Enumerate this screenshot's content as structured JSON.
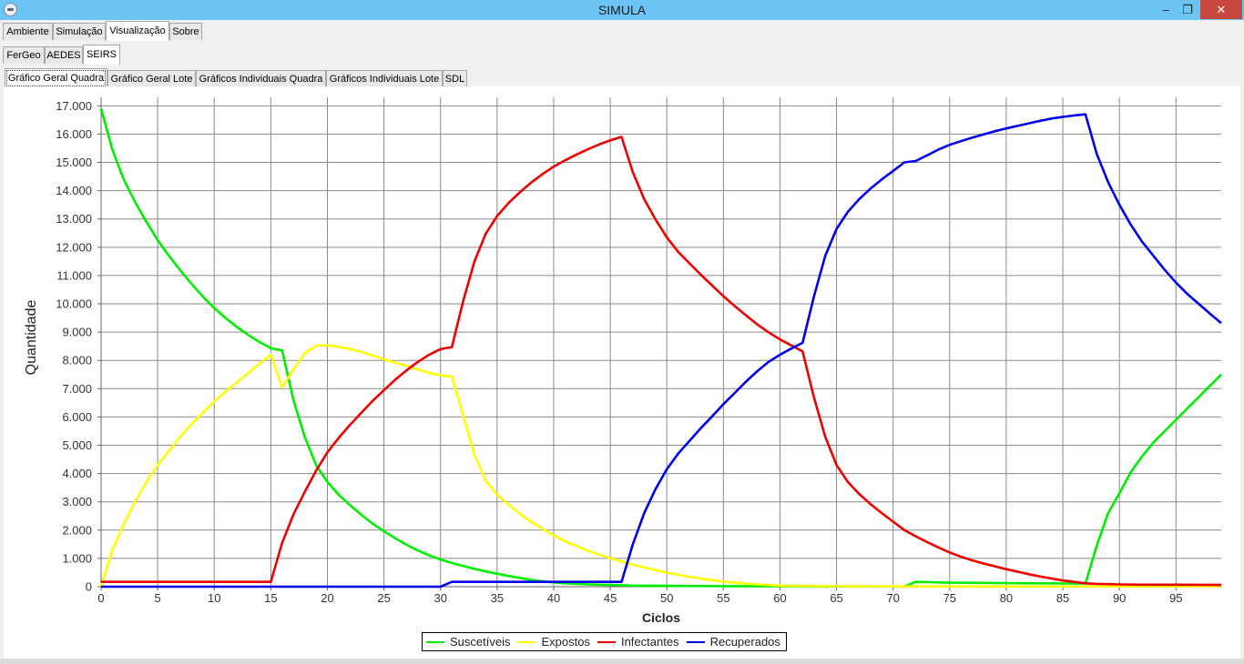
{
  "window": {
    "title": "SIMULA",
    "minimize_glyph": "–",
    "restore_glyph": "❐",
    "close_glyph": "✕"
  },
  "tabs_main": [
    {
      "label": "Ambiente"
    },
    {
      "label": "Simulação"
    },
    {
      "label": "Visualização"
    },
    {
      "label": "Sobre"
    }
  ],
  "tabs_sub": [
    {
      "label": "FerGeo"
    },
    {
      "label": "AEDES"
    },
    {
      "label": "SEIRS"
    }
  ],
  "tabs_chart": [
    {
      "label": "Gráfico Geral Quadra"
    },
    {
      "label": "Gráfico Geral Lote"
    },
    {
      "label": "Gráficos Individuais Quadra"
    },
    {
      "label": "Gráficos Individuais Lote"
    },
    {
      "label": "SDL"
    }
  ],
  "chart_data": {
    "type": "line",
    "xlabel": "Ciclos",
    "ylabel": "Quantidade",
    "xlim": [
      0,
      99
    ],
    "ylim": [
      0,
      17300
    ],
    "x_ticks": [
      0,
      5,
      10,
      15,
      20,
      25,
      30,
      35,
      40,
      45,
      50,
      55,
      60,
      65,
      70,
      75,
      80,
      85,
      90,
      95
    ],
    "y_ticks": [
      0,
      1000,
      2000,
      3000,
      4000,
      5000,
      6000,
      7000,
      8000,
      9000,
      10000,
      11000,
      12000,
      13000,
      14000,
      15000,
      16000,
      17000
    ],
    "y_tick_labels": [
      "0",
      "1.000",
      "2.000",
      "3.000",
      "4.000",
      "5.000",
      "6.000",
      "7.000",
      "8.000",
      "9.000",
      "10.000",
      "11.000",
      "12.000",
      "13.000",
      "14.000",
      "15.000",
      "16.000",
      "17.000"
    ],
    "grid": true,
    "legend_position": "bottom-center",
    "series": [
      {
        "name": "Suscetíveis",
        "color": "#00ee00",
        "points": [
          [
            0,
            16900
          ],
          [
            1,
            15450
          ],
          [
            2,
            14400
          ],
          [
            3,
            13600
          ],
          [
            4,
            12900
          ],
          [
            5,
            12250
          ],
          [
            6,
            11700
          ],
          [
            7,
            11180
          ],
          [
            8,
            10700
          ],
          [
            9,
            10250
          ],
          [
            10,
            9850
          ],
          [
            11,
            9500
          ],
          [
            12,
            9180
          ],
          [
            13,
            8900
          ],
          [
            14,
            8650
          ],
          [
            15,
            8430
          ],
          [
            16,
            8350
          ],
          [
            17,
            6600
          ],
          [
            18,
            5300
          ],
          [
            19,
            4300
          ],
          [
            20,
            3700
          ],
          [
            21,
            3250
          ],
          [
            22,
            2880
          ],
          [
            23,
            2540
          ],
          [
            24,
            2230
          ],
          [
            25,
            1960
          ],
          [
            26,
            1710
          ],
          [
            27,
            1480
          ],
          [
            28,
            1280
          ],
          [
            29,
            1110
          ],
          [
            30,
            960
          ],
          [
            31,
            840
          ],
          [
            32,
            730
          ],
          [
            33,
            630
          ],
          [
            34,
            540
          ],
          [
            35,
            460
          ],
          [
            36,
            380
          ],
          [
            37,
            310
          ],
          [
            38,
            240
          ],
          [
            39,
            190
          ],
          [
            40,
            150
          ],
          [
            41,
            120
          ],
          [
            42,
            100
          ],
          [
            43,
            80
          ],
          [
            44,
            70
          ],
          [
            45,
            60
          ],
          [
            46,
            50
          ],
          [
            47,
            40
          ],
          [
            48,
            35
          ],
          [
            50,
            30
          ],
          [
            55,
            20
          ],
          [
            60,
            15
          ],
          [
            65,
            10
          ],
          [
            70,
            8
          ],
          [
            71,
            5
          ],
          [
            72,
            170
          ],
          [
            73,
            160
          ],
          [
            75,
            140
          ],
          [
            80,
            125
          ],
          [
            85,
            115
          ],
          [
            87,
            110
          ],
          [
            88,
            1450
          ],
          [
            89,
            2600
          ],
          [
            90,
            3300
          ],
          [
            91,
            4050
          ],
          [
            92,
            4600
          ],
          [
            93,
            5100
          ],
          [
            94,
            5500
          ],
          [
            95,
            5900
          ],
          [
            96,
            6300
          ],
          [
            97,
            6700
          ],
          [
            98,
            7100
          ],
          [
            99,
            7500
          ]
        ]
      },
      {
        "name": "Expostos",
        "color": "#ffff00",
        "points": [
          [
            0,
            0
          ],
          [
            1,
            1300
          ],
          [
            2,
            2200
          ],
          [
            3,
            3000
          ],
          [
            4,
            3700
          ],
          [
            5,
            4300
          ],
          [
            6,
            4800
          ],
          [
            7,
            5300
          ],
          [
            8,
            5750
          ],
          [
            9,
            6150
          ],
          [
            10,
            6550
          ],
          [
            11,
            6900
          ],
          [
            12,
            7220
          ],
          [
            13,
            7550
          ],
          [
            14,
            7880
          ],
          [
            15,
            8200
          ],
          [
            16,
            7050
          ],
          [
            17,
            7680
          ],
          [
            18,
            8250
          ],
          [
            19,
            8520
          ],
          [
            20,
            8530
          ],
          [
            21,
            8480
          ],
          [
            22,
            8400
          ],
          [
            23,
            8300
          ],
          [
            24,
            8170
          ],
          [
            25,
            8040
          ],
          [
            26,
            7920
          ],
          [
            27,
            7800
          ],
          [
            28,
            7680
          ],
          [
            29,
            7560
          ],
          [
            30,
            7470
          ],
          [
            31,
            7430
          ],
          [
            32,
            6050
          ],
          [
            33,
            4650
          ],
          [
            34,
            3750
          ],
          [
            35,
            3250
          ],
          [
            36,
            2900
          ],
          [
            37,
            2580
          ],
          [
            38,
            2300
          ],
          [
            39,
            2050
          ],
          [
            40,
            1810
          ],
          [
            41,
            1610
          ],
          [
            42,
            1440
          ],
          [
            43,
            1280
          ],
          [
            44,
            1140
          ],
          [
            45,
            1010
          ],
          [
            46,
            890
          ],
          [
            47,
            780
          ],
          [
            48,
            680
          ],
          [
            49,
            590
          ],
          [
            50,
            500
          ],
          [
            51,
            420
          ],
          [
            52,
            350
          ],
          [
            53,
            290
          ],
          [
            54,
            230
          ],
          [
            55,
            180
          ],
          [
            56,
            140
          ],
          [
            57,
            110
          ],
          [
            58,
            80
          ],
          [
            59,
            60
          ],
          [
            60,
            40
          ],
          [
            62,
            25
          ],
          [
            65,
            15
          ],
          [
            70,
            10
          ],
          [
            80,
            5
          ],
          [
            90,
            8
          ],
          [
            99,
            20
          ]
        ]
      },
      {
        "name": "Infectantes",
        "color": "#ee0000",
        "points": [
          [
            0,
            170
          ],
          [
            5,
            170
          ],
          [
            10,
            170
          ],
          [
            15,
            170
          ],
          [
            16,
            1550
          ],
          [
            17,
            2550
          ],
          [
            18,
            3350
          ],
          [
            19,
            4100
          ],
          [
            20,
            4750
          ],
          [
            21,
            5260
          ],
          [
            22,
            5720
          ],
          [
            23,
            6150
          ],
          [
            24,
            6570
          ],
          [
            25,
            6950
          ],
          [
            26,
            7320
          ],
          [
            27,
            7650
          ],
          [
            28,
            7950
          ],
          [
            29,
            8200
          ],
          [
            30,
            8400
          ],
          [
            31,
            8470
          ],
          [
            32,
            10100
          ],
          [
            33,
            11500
          ],
          [
            34,
            12480
          ],
          [
            35,
            13100
          ],
          [
            36,
            13560
          ],
          [
            37,
            13940
          ],
          [
            38,
            14280
          ],
          [
            39,
            14580
          ],
          [
            40,
            14850
          ],
          [
            41,
            15070
          ],
          [
            42,
            15270
          ],
          [
            43,
            15460
          ],
          [
            44,
            15630
          ],
          [
            45,
            15780
          ],
          [
            46,
            15900
          ],
          [
            47,
            14650
          ],
          [
            48,
            13700
          ],
          [
            49,
            12980
          ],
          [
            50,
            12350
          ],
          [
            51,
            11840
          ],
          [
            52,
            11430
          ],
          [
            53,
            11030
          ],
          [
            54,
            10650
          ],
          [
            55,
            10270
          ],
          [
            56,
            9920
          ],
          [
            57,
            9590
          ],
          [
            58,
            9270
          ],
          [
            59,
            8990
          ],
          [
            60,
            8740
          ],
          [
            61,
            8530
          ],
          [
            62,
            8320
          ],
          [
            63,
            6700
          ],
          [
            64,
            5300
          ],
          [
            65,
            4300
          ],
          [
            66,
            3700
          ],
          [
            67,
            3280
          ],
          [
            68,
            2920
          ],
          [
            69,
            2600
          ],
          [
            70,
            2300
          ],
          [
            71,
            2000
          ],
          [
            72,
            1780
          ],
          [
            73,
            1580
          ],
          [
            74,
            1390
          ],
          [
            75,
            1210
          ],
          [
            76,
            1060
          ],
          [
            77,
            930
          ],
          [
            78,
            820
          ],
          [
            79,
            720
          ],
          [
            80,
            620
          ],
          [
            81,
            530
          ],
          [
            82,
            440
          ],
          [
            83,
            360
          ],
          [
            84,
            290
          ],
          [
            85,
            220
          ],
          [
            86,
            170
          ],
          [
            87,
            120
          ],
          [
            88,
            100
          ],
          [
            89,
            90
          ],
          [
            90,
            80
          ],
          [
            92,
            70
          ],
          [
            95,
            70
          ],
          [
            99,
            60
          ]
        ]
      },
      {
        "name": "Recuperados",
        "color": "#0000ee",
        "points": [
          [
            0,
            0
          ],
          [
            10,
            0
          ],
          [
            20,
            0
          ],
          [
            30,
            0
          ],
          [
            31,
            170
          ],
          [
            35,
            170
          ],
          [
            40,
            170
          ],
          [
            45,
            170
          ],
          [
            46,
            170
          ],
          [
            47,
            1500
          ],
          [
            48,
            2600
          ],
          [
            49,
            3450
          ],
          [
            50,
            4150
          ],
          [
            51,
            4700
          ],
          [
            52,
            5150
          ],
          [
            53,
            5600
          ],
          [
            54,
            6020
          ],
          [
            55,
            6450
          ],
          [
            56,
            6850
          ],
          [
            57,
            7250
          ],
          [
            58,
            7620
          ],
          [
            59,
            7950
          ],
          [
            60,
            8200
          ],
          [
            61,
            8420
          ],
          [
            62,
            8620
          ],
          [
            63,
            10250
          ],
          [
            64,
            11700
          ],
          [
            65,
            12650
          ],
          [
            66,
            13250
          ],
          [
            67,
            13700
          ],
          [
            68,
            14070
          ],
          [
            69,
            14400
          ],
          [
            70,
            14700
          ],
          [
            71,
            15000
          ],
          [
            72,
            15050
          ],
          [
            73,
            15250
          ],
          [
            74,
            15450
          ],
          [
            75,
            15620
          ],
          [
            76,
            15750
          ],
          [
            77,
            15880
          ],
          [
            78,
            15990
          ],
          [
            79,
            16100
          ],
          [
            80,
            16200
          ],
          [
            81,
            16290
          ],
          [
            82,
            16380
          ],
          [
            83,
            16470
          ],
          [
            84,
            16550
          ],
          [
            85,
            16610
          ],
          [
            86,
            16660
          ],
          [
            87,
            16700
          ],
          [
            88,
            15300
          ],
          [
            89,
            14300
          ],
          [
            90,
            13500
          ],
          [
            91,
            12800
          ],
          [
            92,
            12200
          ],
          [
            93,
            11700
          ],
          [
            94,
            11200
          ],
          [
            95,
            10750
          ],
          [
            96,
            10350
          ],
          [
            97,
            10000
          ],
          [
            98,
            9650
          ],
          [
            99,
            9320
          ]
        ]
      }
    ]
  }
}
